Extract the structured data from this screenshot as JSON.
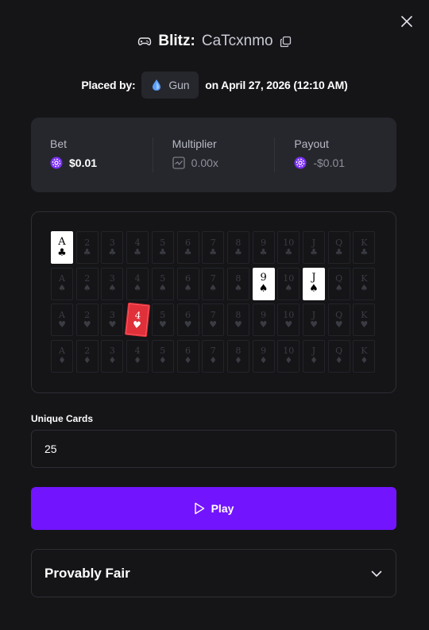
{
  "header": {
    "game_name": "Blitz:",
    "game_id": "CaTcxnmo"
  },
  "placed": {
    "prefix": "Placed by:",
    "username": "Gun",
    "date_text": "on April 27, 2026 (12:10 AM)"
  },
  "stats": {
    "bet": {
      "label": "Bet",
      "value": "$0.01"
    },
    "multiplier": {
      "label": "Multiplier",
      "value": "0.00x"
    },
    "payout": {
      "label": "Payout",
      "value": "-$0.01"
    }
  },
  "board": {
    "ranks": [
      "A",
      "2",
      "3",
      "4",
      "5",
      "6",
      "7",
      "8",
      "9",
      "10",
      "J",
      "Q",
      "K"
    ],
    "suits": [
      "♣",
      "♠",
      "♥",
      "♦"
    ],
    "revealed": [
      {
        "row": 0,
        "rank": "A",
        "suit": "♣",
        "style": "up"
      },
      {
        "row": 1,
        "rank": "9",
        "suit": "♠",
        "style": "up"
      },
      {
        "row": 1,
        "rank": "J",
        "suit": "♠",
        "style": "up"
      },
      {
        "row": 2,
        "rank": "4",
        "suit": "♥",
        "style": "red"
      }
    ]
  },
  "unique_cards": {
    "label": "Unique Cards",
    "value": "25"
  },
  "play_button": {
    "label": "Play"
  },
  "provably_fair": {
    "label": "Provably Fair"
  },
  "colors": {
    "accent": "#7314ff",
    "background": "#151518",
    "panel": "#26272d",
    "chip": "#7b2ff7",
    "drop": "#5aa0ff",
    "red_card": "#e0303a"
  },
  "icons": {
    "close": "close-icon",
    "game": "gamepad-icon",
    "copy": "copy-icon",
    "user": "droplet-icon",
    "chip": "casino-chip-icon",
    "multiplier": "chart-icon",
    "play": "play-icon",
    "expand": "chevron-down-icon"
  }
}
